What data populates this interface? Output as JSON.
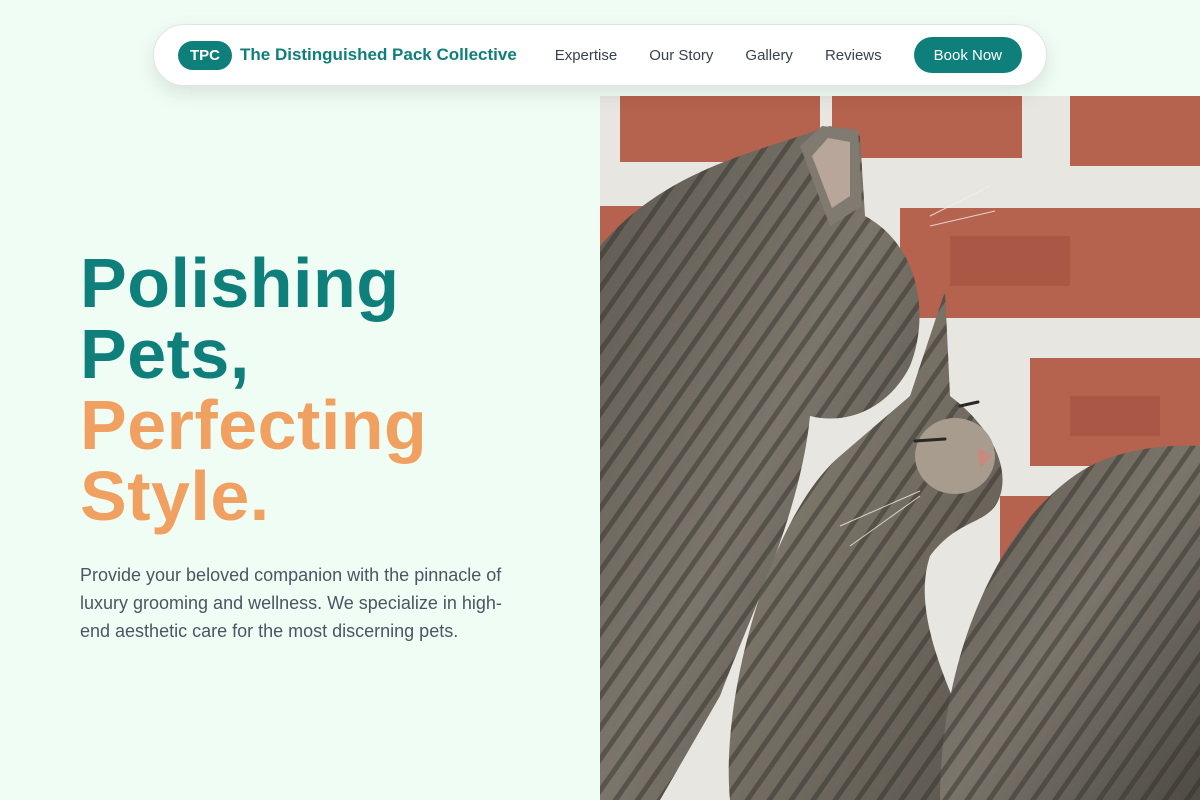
{
  "nav": {
    "logo_badge": "TPC",
    "brand_name": "The Distinguished Pack Collective",
    "links": [
      "Expertise",
      "Our Story",
      "Gallery",
      "Reviews"
    ],
    "cta": "Book Now"
  },
  "hero": {
    "title_line1": "Polishing",
    "title_line2": "Pets,",
    "title_line3": "Perfecting",
    "title_line4": "Style.",
    "description": "Provide your beloved companion with the pinnacle of luxury grooming and wellness. We specialize in high-end aesthetic care for the most discerning pets.",
    "image_subject": "two tabby cats cuddling in front of a brick wall"
  },
  "colors": {
    "background": "#f0fdf4",
    "brand_teal": "#0f7f7b",
    "accent_orange": "#f0a060",
    "body_text": "#4b5563"
  }
}
